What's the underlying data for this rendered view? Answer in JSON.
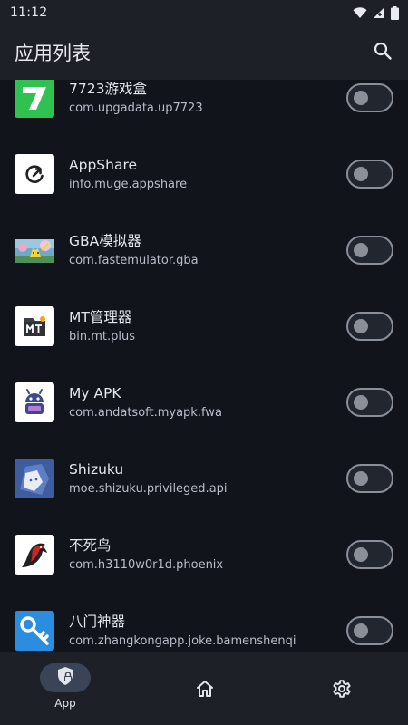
{
  "status_bar": {
    "time": "11:12"
  },
  "app_bar": {
    "title": "应用列表"
  },
  "apps": [
    {
      "name": "7723游戏盒",
      "package": "com.upgadata.up7723",
      "enabled": false,
      "icon": "7723-logo-icon"
    },
    {
      "name": "AppShare",
      "package": "info.muge.appshare",
      "enabled": false,
      "icon": "appshare-logo-icon"
    },
    {
      "name": "GBA模拟器",
      "package": "com.fastemulator.gba",
      "enabled": false,
      "icon": "gba-emulator-icon"
    },
    {
      "name": "MT管理器",
      "package": "bin.mt.plus",
      "enabled": false,
      "icon": "mt-manager-icon"
    },
    {
      "name": "My APK",
      "package": "com.andatsoft.myapk.fwa",
      "enabled": false,
      "icon": "my-apk-robot-icon"
    },
    {
      "name": "Shizuku",
      "package": "moe.shizuku.privileged.api",
      "enabled": false,
      "icon": "shizuku-icon"
    },
    {
      "name": "不死鸟",
      "package": "com.h3110w0r1d.phoenix",
      "enabled": false,
      "icon": "phoenix-bird-icon"
    },
    {
      "name": "八门神器",
      "package": "com.zhangkongapp.joke.bamenshenqi",
      "enabled": false,
      "icon": "key-magnifier-icon"
    }
  ],
  "bottom_nav": {
    "items": [
      {
        "label": "App",
        "icon": "shield-lock-icon",
        "selected": true
      },
      {
        "label": "",
        "icon": "home-icon",
        "selected": false
      },
      {
        "label": "",
        "icon": "gear-icon",
        "selected": false
      }
    ]
  },
  "colors": {
    "background": "#11141b",
    "bar": "#1d2027",
    "nav_indicator": "#3a4456",
    "switch_outline": "#8b8f99"
  }
}
